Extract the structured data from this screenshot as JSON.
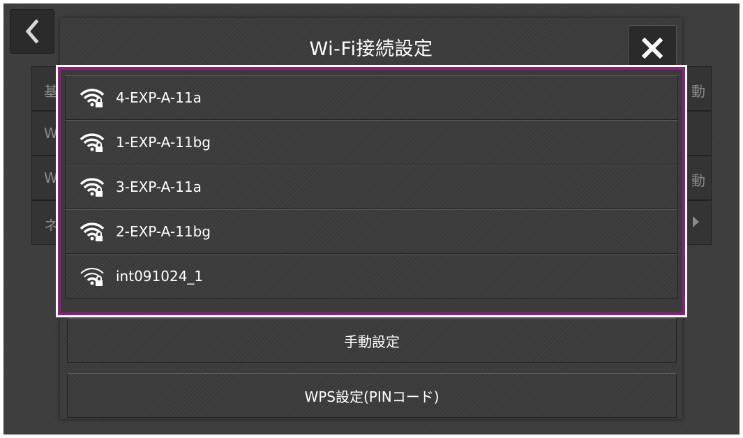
{
  "background": {
    "back_icon": "chevron-left-icon",
    "rows": [
      {
        "left_char": "基",
        "right_char": "動"
      },
      {
        "left_char": "W",
        "right_char": ""
      },
      {
        "left_char": "W",
        "right_char": "動"
      },
      {
        "left_char": "ネ",
        "right_char": ""
      }
    ]
  },
  "dialog": {
    "title": "Wi-Fi接続設定",
    "close_icon": "close-icon",
    "networks": [
      {
        "ssid": "4-EXP-A-11a",
        "icon": "wifi-locked-icon"
      },
      {
        "ssid": "1-EXP-A-11bg",
        "icon": "wifi-locked-icon"
      },
      {
        "ssid": "3-EXP-A-11a",
        "icon": "wifi-locked-icon"
      },
      {
        "ssid": "2-EXP-A-11bg",
        "icon": "wifi-locked-icon"
      },
      {
        "ssid": "int091024_1",
        "icon": "wifi-locked-weak-icon"
      }
    ],
    "manual_setup_label": "手動設定",
    "wps_setup_label": "WPS設定(PINコード)"
  },
  "colors": {
    "highlight_border": "#8e1f7a",
    "background": "#3c3c3c"
  }
}
